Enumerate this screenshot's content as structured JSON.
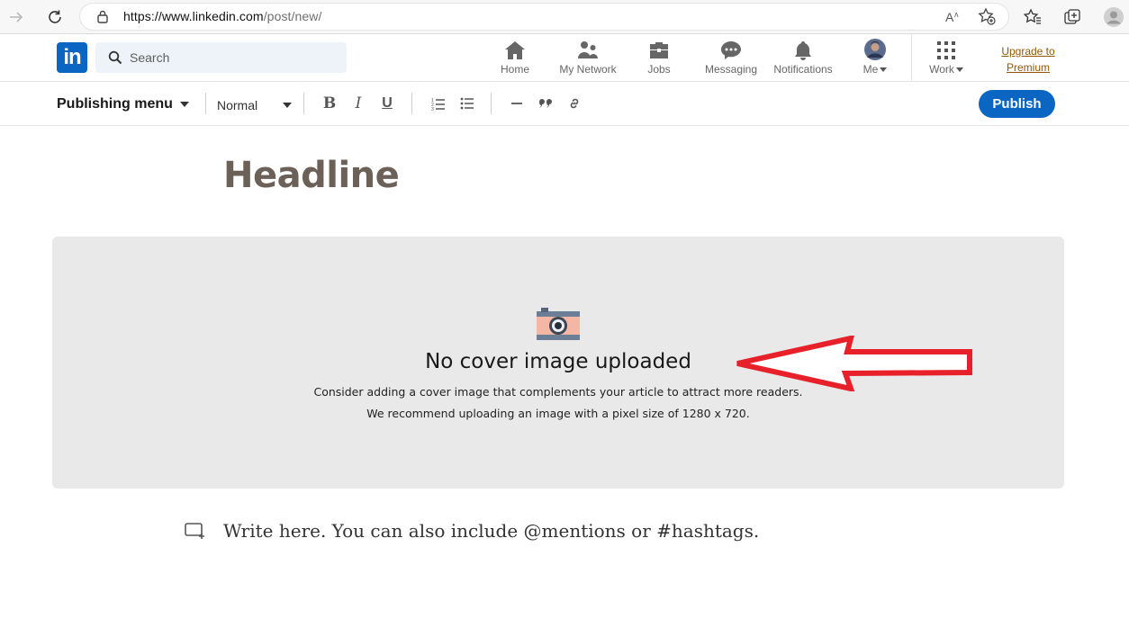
{
  "browser": {
    "url_host": "https://www.linkedin.com",
    "url_path": "/post/new/",
    "back_icon": "arrow-right-icon",
    "reload_icon": "reload-icon"
  },
  "nav": {
    "logo": "in",
    "search_placeholder": "Search",
    "items": [
      {
        "label": "Home",
        "icon": "home-icon"
      },
      {
        "label": "My Network",
        "icon": "network-icon"
      },
      {
        "label": "Jobs",
        "icon": "briefcase-icon"
      },
      {
        "label": "Messaging",
        "icon": "messaging-icon"
      },
      {
        "label": "Notifications",
        "icon": "bell-icon"
      },
      {
        "label": "Me",
        "icon": "avatar"
      },
      {
        "label": "Work",
        "icon": "grid-icon"
      }
    ],
    "upgrade_line1": "Upgrade to",
    "upgrade_line2": "Premium"
  },
  "toolbar": {
    "publishing_menu": "Publishing menu",
    "text_style": "Normal",
    "bold": "B",
    "italic": "I",
    "underline": "U",
    "publish": "Publish"
  },
  "editor": {
    "headline": "Headline",
    "cover_title": "No cover image uploaded",
    "cover_line1": "Consider adding a cover image that complements your article to attract more readers.",
    "cover_line2": "We recommend uploading an image with a pixel size of 1280 x 720.",
    "body_placeholder": "Write here. You can also include @mentions or #hashtags."
  },
  "colors": {
    "brand": "#0a66c2",
    "premium": "#915907",
    "annotation_arrow": "#e8202a"
  }
}
